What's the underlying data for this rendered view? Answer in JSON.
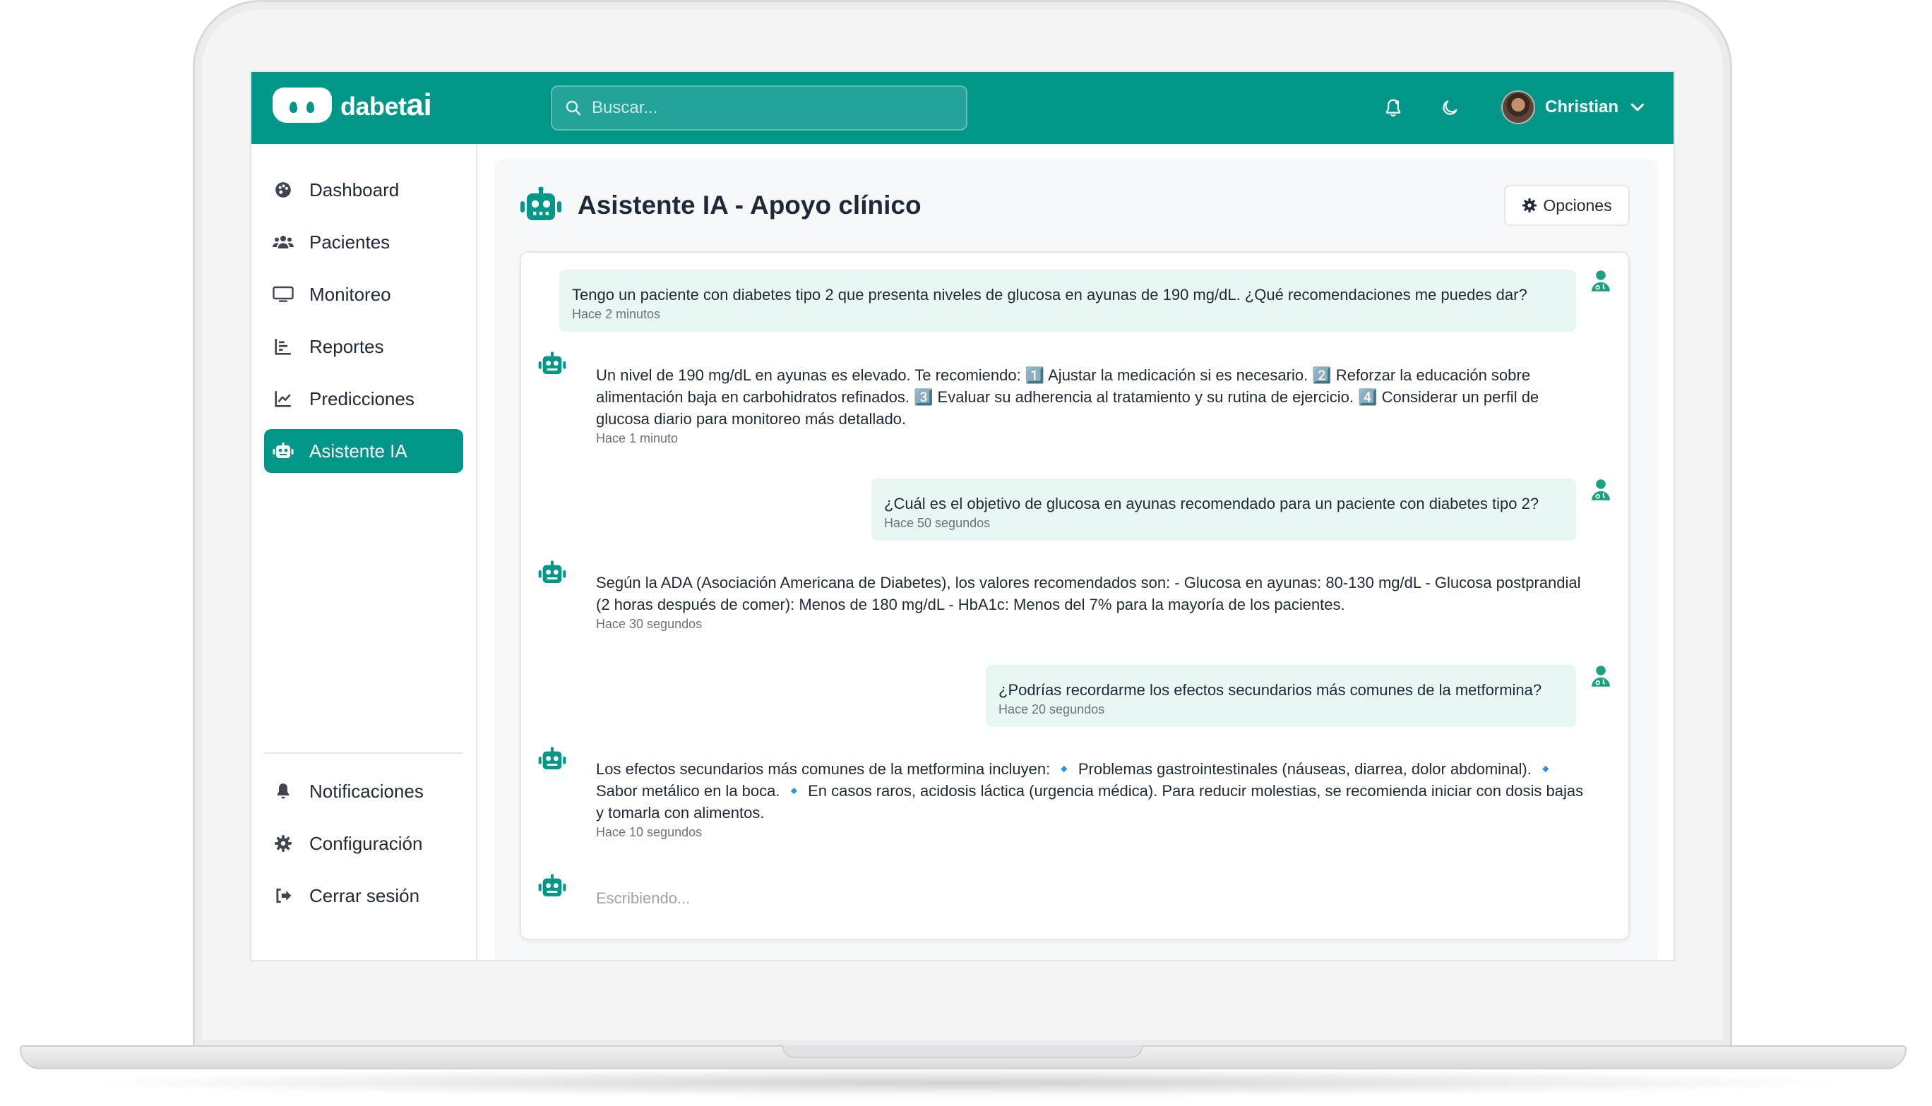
{
  "app": {
    "logo_text": "dabet",
    "logo_ai": "ai",
    "brand_color": "#009688"
  },
  "search": {
    "placeholder": "Buscar..."
  },
  "header": {
    "user_name": "Christian",
    "icons": [
      "bell-icon",
      "moon-icon",
      "chevron-down-icon"
    ]
  },
  "sidebar": {
    "items": [
      {
        "label": "Dashboard",
        "icon": "palette-icon"
      },
      {
        "label": "Pacientes",
        "icon": "users-icon"
      },
      {
        "label": "Monitoreo",
        "icon": "monitor-icon"
      },
      {
        "label": "Reportes",
        "icon": "bar-chart-icon"
      },
      {
        "label": "Predicciones",
        "icon": "line-chart-icon"
      },
      {
        "label": "Asistente IA",
        "icon": "robot-icon",
        "active": true
      }
    ],
    "bottom_items": [
      {
        "label": "Notificaciones",
        "icon": "bell-icon"
      },
      {
        "label": "Configuración",
        "icon": "gear-icon"
      },
      {
        "label": "Cerrar sesión",
        "icon": "sign-out-icon"
      }
    ]
  },
  "page": {
    "title": "Asistente IA - Apoyo clínico",
    "options_label": "Opciones"
  },
  "chat": {
    "messages": [
      {
        "role": "user",
        "text": "Tengo un paciente con diabetes tipo 2 que presenta niveles de glucosa en ayunas de 190 mg/dL. ¿Qué recomendaciones me puedes dar?",
        "time": "Hace 2 minutos"
      },
      {
        "role": "bot",
        "text": "Un nivel de 190 mg/dL en ayunas es elevado. Te recomiendo: 1️⃣ Ajustar la medicación si es necesario. 2️⃣ Reforzar la educación sobre alimentación baja en carbohidratos refinados. 3️⃣ Evaluar su adherencia al tratamiento y su rutina de ejercicio. 4️⃣ Considerar un perfil de glucosa diario para monitoreo más detallado.",
        "time": "Hace 1 minuto"
      },
      {
        "role": "user",
        "text": "¿Cuál es el objetivo de glucosa en ayunas recomendado para un paciente con diabetes tipo 2?",
        "time": "Hace 50 segundos"
      },
      {
        "role": "bot",
        "text": "Según la ADA (Asociación Americana de Diabetes), los valores recomendados son: - Glucosa en ayunas: 80-130 mg/dL - Glucosa postprandial (2 horas después de comer): Menos de 180 mg/dL - HbA1c: Menos del 7% para la mayoría de los pacientes.",
        "time": "Hace 30 segundos"
      },
      {
        "role": "user",
        "text": "¿Podrías recordarme los efectos secundarios más comunes de la metformina?",
        "time": "Hace 20 segundos"
      },
      {
        "role": "bot",
        "text": "Los efectos secundarios más comunes de la metformina incluyen: 🔹 Problemas gastrointestinales (náuseas, diarrea, dolor abdominal). 🔹 Sabor metálico en la boca. 🔹 En casos raros, acidosis láctica (urgencia médica). Para reducir molestias, se recomienda iniciar con dosis bajas y tomarla con alimentos.",
        "time": "Hace 10 segundos"
      }
    ],
    "typing_text": "Escribiendo..."
  }
}
